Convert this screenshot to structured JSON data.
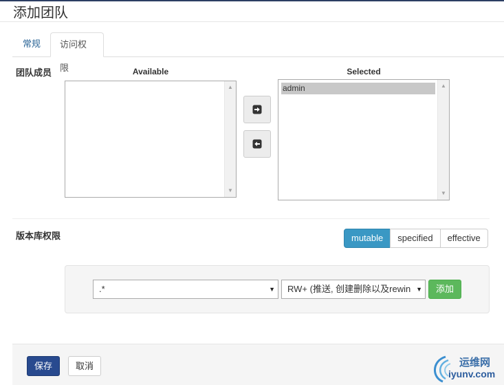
{
  "page": {
    "title": "添加团队"
  },
  "tabs": [
    {
      "label": "常规"
    },
    {
      "label": "访问权限"
    }
  ],
  "members": {
    "label": "团队成员",
    "available_heading": "Available",
    "selected_heading": "Selected",
    "available_items": [],
    "selected_items": [
      "admin"
    ],
    "add_icon": "arrow-right-icon",
    "remove_icon": "arrow-left-icon"
  },
  "repo_permissions": {
    "label": "版本库权限",
    "modes": [
      "mutable",
      "specified",
      "effective"
    ],
    "active_mode": "mutable",
    "pattern_value": ".*",
    "permission_value": "RW+ (推送, 创建删除以及rewin",
    "add_label": "添加"
  },
  "footer": {
    "save_label": "保存",
    "cancel_label": "取消"
  },
  "watermark": {
    "name": "运维网",
    "url": "iyunv.com"
  },
  "colors": {
    "accent": "#3a98c4",
    "primary": "#284a8f",
    "success": "#5cb85c"
  }
}
